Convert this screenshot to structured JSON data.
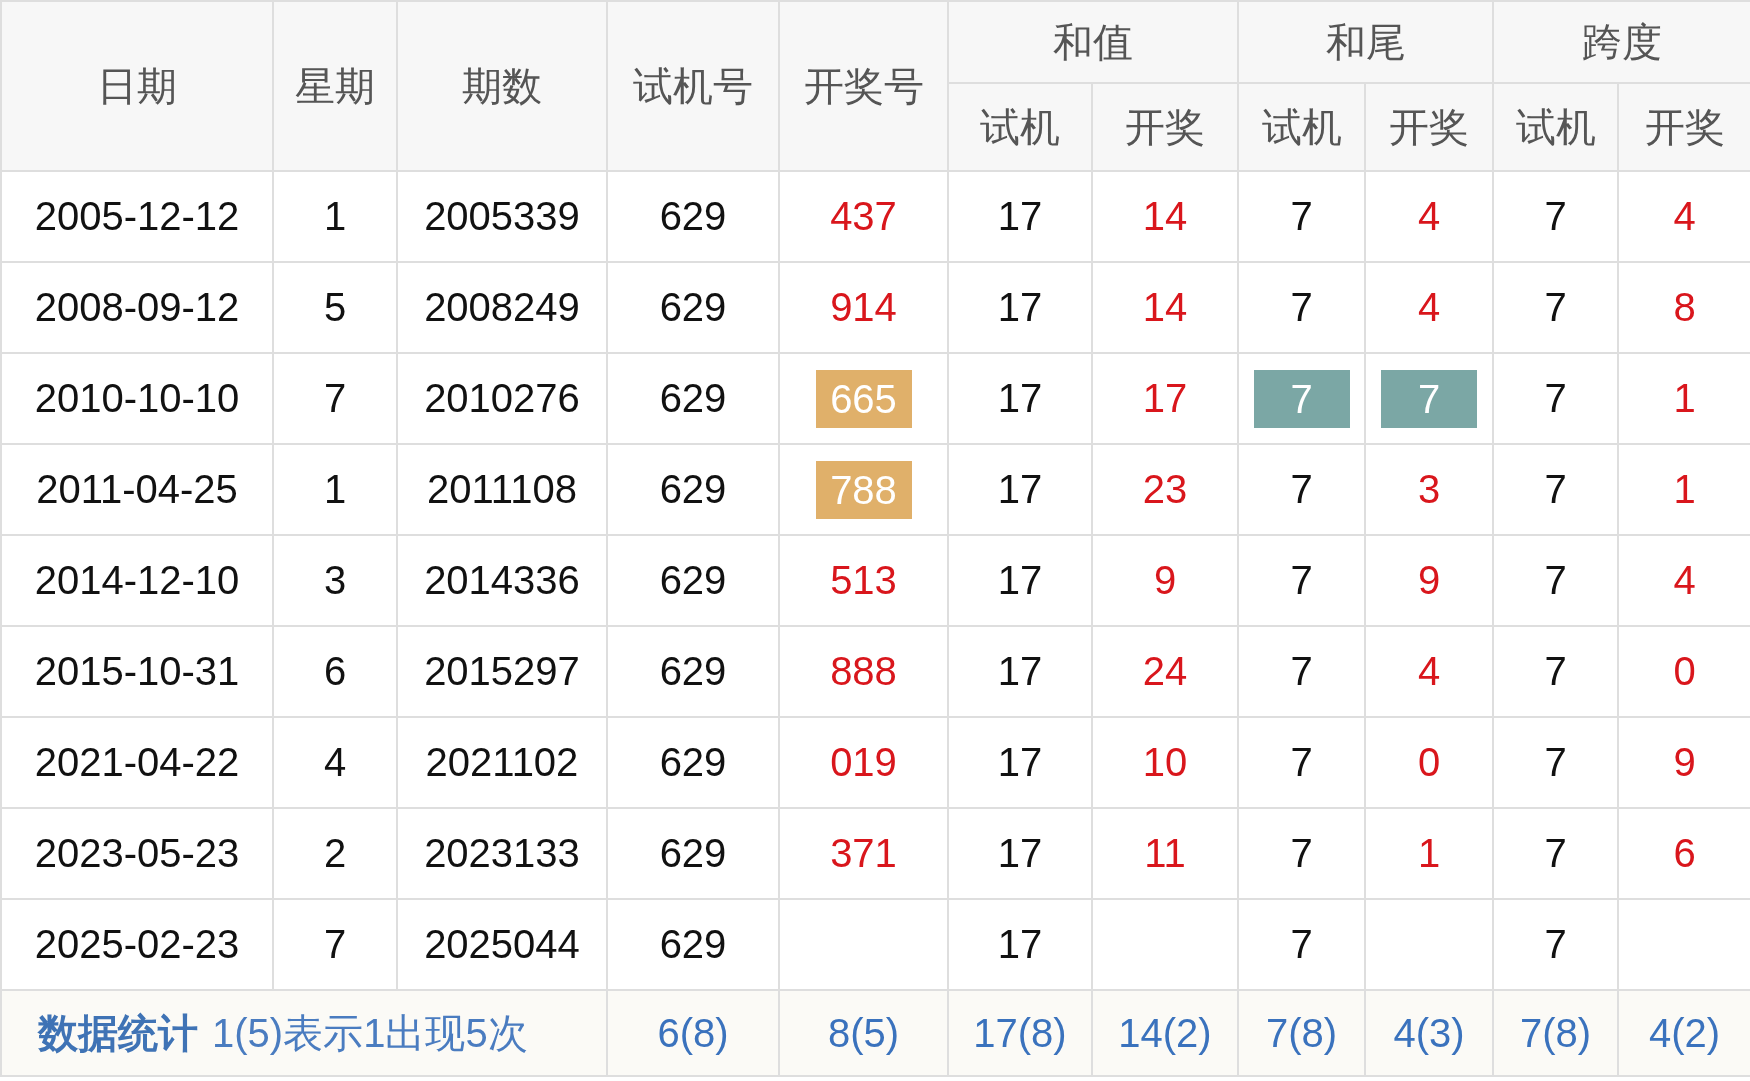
{
  "header": {
    "date": "日期",
    "weekday": "星期",
    "issue": "期数",
    "trial": "试机号",
    "draw": "开奖号",
    "groups": [
      {
        "title": "和值",
        "sub": [
          "试机",
          "开奖"
        ]
      },
      {
        "title": "和尾",
        "sub": [
          "试机",
          "开奖"
        ]
      },
      {
        "title": "跨度",
        "sub": [
          "试机",
          "开奖"
        ]
      }
    ]
  },
  "rows": [
    {
      "cells": [
        {
          "text": "2005-12-12",
          "kind": "plain"
        },
        {
          "text": "1",
          "kind": "plain"
        },
        {
          "text": "2005339",
          "kind": "plain"
        },
        {
          "text": "629",
          "kind": "plain"
        },
        {
          "text": "437",
          "kind": "draw"
        },
        {
          "text": "17",
          "kind": "plain"
        },
        {
          "text": "14",
          "kind": "draw"
        },
        {
          "text": "7",
          "kind": "plain"
        },
        {
          "text": "4",
          "kind": "draw"
        },
        {
          "text": "7",
          "kind": "plain"
        },
        {
          "text": "4",
          "kind": "draw"
        }
      ]
    },
    {
      "cells": [
        {
          "text": "2008-09-12",
          "kind": "plain"
        },
        {
          "text": "5",
          "kind": "plain"
        },
        {
          "text": "2008249",
          "kind": "plain"
        },
        {
          "text": "629",
          "kind": "plain"
        },
        {
          "text": "914",
          "kind": "draw"
        },
        {
          "text": "17",
          "kind": "plain"
        },
        {
          "text": "14",
          "kind": "draw"
        },
        {
          "text": "7",
          "kind": "plain"
        },
        {
          "text": "4",
          "kind": "draw"
        },
        {
          "text": "7",
          "kind": "plain"
        },
        {
          "text": "8",
          "kind": "draw"
        }
      ]
    },
    {
      "cells": [
        {
          "text": "2010-10-10",
          "kind": "plain"
        },
        {
          "text": "7",
          "kind": "plain"
        },
        {
          "text": "2010276",
          "kind": "plain"
        },
        {
          "text": "629",
          "kind": "plain"
        },
        {
          "text": "665",
          "color": "#e0b06a"
        },
        {
          "text": "17",
          "kind": "plain"
        },
        {
          "text": "17",
          "kind": "draw"
        },
        {
          "text": "7",
          "color": "#7ba7a5"
        },
        {
          "text": "7",
          "color": "#7ba7a5"
        },
        {
          "text": "7",
          "kind": "plain"
        },
        {
          "text": "1",
          "kind": "draw"
        }
      ]
    },
    {
      "cells": [
        {
          "text": "2011-04-25",
          "kind": "plain"
        },
        {
          "text": "1",
          "kind": "plain"
        },
        {
          "text": "2011108",
          "kind": "plain"
        },
        {
          "text": "629",
          "kind": "plain"
        },
        {
          "text": "788",
          "color": "#e0b06a"
        },
        {
          "text": "17",
          "kind": "plain"
        },
        {
          "text": "23",
          "kind": "draw"
        },
        {
          "text": "7",
          "kind": "plain"
        },
        {
          "text": "3",
          "kind": "draw"
        },
        {
          "text": "7",
          "kind": "plain"
        },
        {
          "text": "1",
          "kind": "draw"
        }
      ]
    },
    {
      "cells": [
        {
          "text": "2014-12-10",
          "kind": "plain"
        },
        {
          "text": "3",
          "kind": "plain"
        },
        {
          "text": "2014336",
          "kind": "plain"
        },
        {
          "text": "629",
          "kind": "plain"
        },
        {
          "text": "513",
          "kind": "draw"
        },
        {
          "text": "17",
          "kind": "plain"
        },
        {
          "text": "9",
          "kind": "draw"
        },
        {
          "text": "7",
          "kind": "plain"
        },
        {
          "text": "9",
          "kind": "draw"
        },
        {
          "text": "7",
          "kind": "plain"
        },
        {
          "text": "4",
          "kind": "draw"
        }
      ]
    },
    {
      "cells": [
        {
          "text": "2015-10-31",
          "kind": "plain"
        },
        {
          "text": "6",
          "kind": "plain"
        },
        {
          "text": "2015297",
          "kind": "plain"
        },
        {
          "text": "629",
          "kind": "plain"
        },
        {
          "text": "888",
          "kind": "draw"
        },
        {
          "text": "17",
          "kind": "plain"
        },
        {
          "text": "24",
          "kind": "draw"
        },
        {
          "text": "7",
          "kind": "plain"
        },
        {
          "text": "4",
          "kind": "draw"
        },
        {
          "text": "7",
          "kind": "plain"
        },
        {
          "text": "0",
          "kind": "draw"
        }
      ]
    },
    {
      "cells": [
        {
          "text": "2021-04-22",
          "kind": "plain"
        },
        {
          "text": "4",
          "kind": "plain"
        },
        {
          "text": "2021102",
          "kind": "plain"
        },
        {
          "text": "629",
          "kind": "plain"
        },
        {
          "text": "019",
          "kind": "draw"
        },
        {
          "text": "17",
          "kind": "plain"
        },
        {
          "text": "10",
          "kind": "draw"
        },
        {
          "text": "7",
          "kind": "plain"
        },
        {
          "text": "0",
          "kind": "draw"
        },
        {
          "text": "7",
          "kind": "plain"
        },
        {
          "text": "9",
          "kind": "draw"
        }
      ]
    },
    {
      "cells": [
        {
          "text": "2023-05-23",
          "kind": "plain"
        },
        {
          "text": "2",
          "kind": "plain"
        },
        {
          "text": "2023133",
          "kind": "plain"
        },
        {
          "text": "629",
          "kind": "plain"
        },
        {
          "text": "371",
          "kind": "draw"
        },
        {
          "text": "17",
          "kind": "plain"
        },
        {
          "text": "11",
          "kind": "draw"
        },
        {
          "text": "7",
          "kind": "plain"
        },
        {
          "text": "1",
          "kind": "draw"
        },
        {
          "text": "7",
          "kind": "plain"
        },
        {
          "text": "6",
          "kind": "draw"
        }
      ]
    },
    {
      "cells": [
        {
          "text": "2025-02-23",
          "kind": "plain"
        },
        {
          "text": "7",
          "kind": "plain"
        },
        {
          "text": "2025044",
          "kind": "plain"
        },
        {
          "text": "629",
          "kind": "plain"
        },
        null,
        {
          "text": "17",
          "kind": "plain"
        },
        null,
        {
          "text": "7",
          "kind": "plain"
        },
        null,
        {
          "text": "7",
          "kind": "plain"
        },
        null
      ]
    }
  ],
  "footer": {
    "label": "数据统计",
    "note": "1(5)表示1出现5次",
    "stats": [
      "6(8)",
      "8(5)",
      "17(8)",
      "14(2)",
      "7(8)",
      "4(3)",
      "7(8)",
      "4(2)"
    ]
  }
}
